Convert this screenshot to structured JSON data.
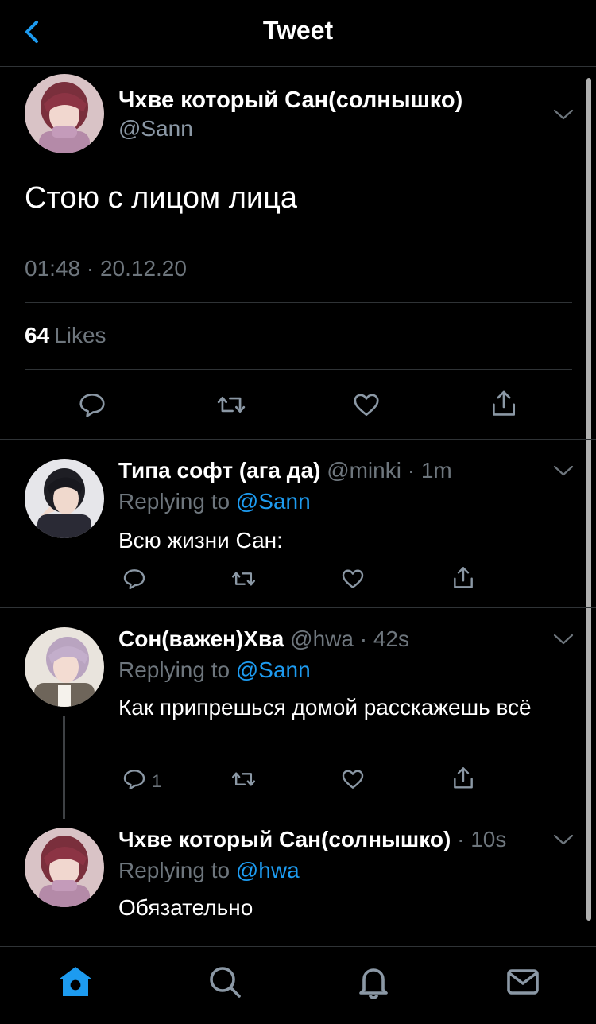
{
  "header": {
    "title": "Tweet",
    "back_icon": "chevron-left-icon"
  },
  "colors": {
    "accent": "#1d9bf0",
    "background": "#000000",
    "muted": "#6e767d",
    "divider": "#2f3336"
  },
  "main_tweet": {
    "name": "Чхве который Сан(солнышко)",
    "handle": "@Sann",
    "text": "Стою с лицом лица",
    "timestamp": "01:48 · 20.12.20",
    "likes_count": "64",
    "likes_label": "Likes",
    "actions": [
      "reply-icon",
      "retweet-icon",
      "like-icon",
      "share-icon"
    ]
  },
  "replies": [
    {
      "name": "Типа софт (ага да)",
      "meta": "@minki · 1m",
      "replying_prefix": "Replying to",
      "replying_to": "@Sann",
      "text": "Всю жизни Сан:",
      "reply_count": ""
    },
    {
      "name": "Сон(важен)Хва",
      "meta": "@hwa · 42s",
      "replying_prefix": "Replying to",
      "replying_to": "@Sann",
      "text": "Как припрешься домой расскажешь всё",
      "reply_count": "1"
    },
    {
      "name": "Чхве который Сан(солнышко)",
      "meta": "· 10s",
      "replying_prefix": "Replying to",
      "replying_to": "@hwa",
      "text": "Обязательно",
      "reply_count": ""
    }
  ],
  "tabbar": [
    "home-icon",
    "search-icon",
    "notifications-icon",
    "messages-icon"
  ]
}
